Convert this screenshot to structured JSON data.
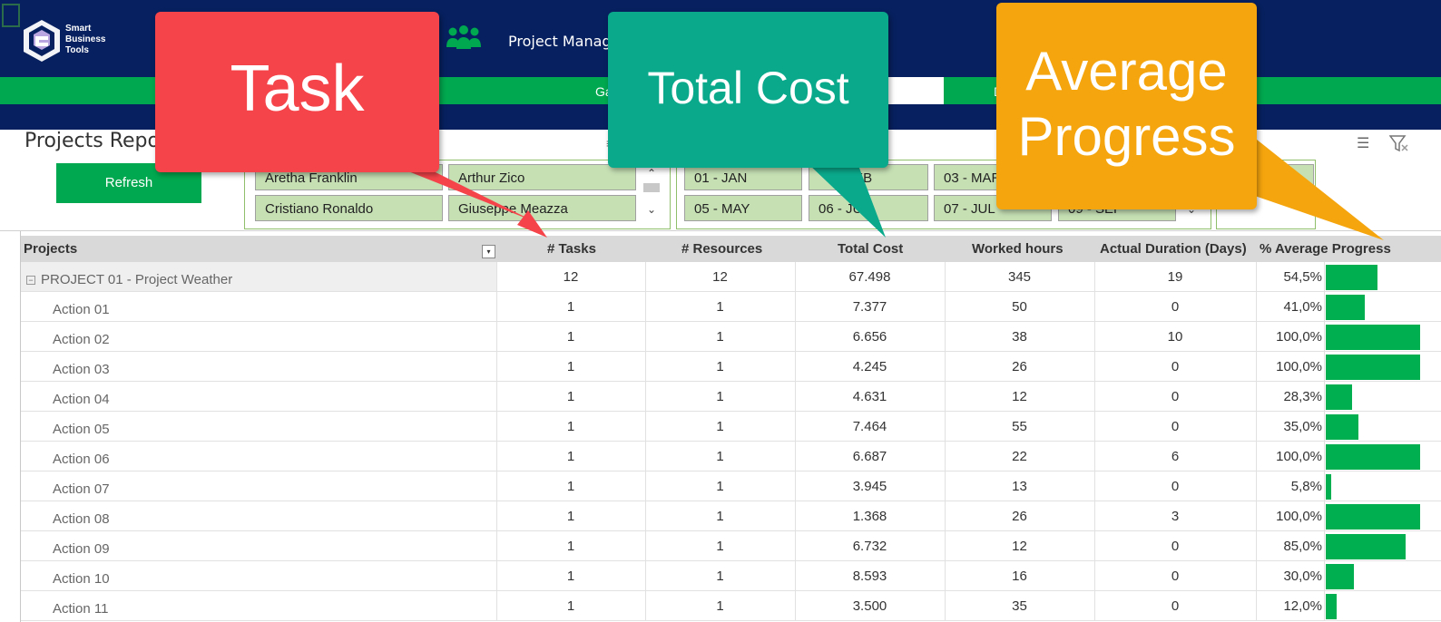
{
  "header": {
    "logo_lines": [
      "Smart",
      "Business",
      "Tools"
    ],
    "app_title": "Project Managem",
    "nav": [
      {
        "label": "Ga",
        "active": false
      },
      {
        "label": "",
        "active": true
      },
      {
        "label": "D",
        "active": false
      }
    ],
    "people_icon": "people-icon"
  },
  "controls": {
    "report_title": "Projects Repo",
    "refresh_label": "Refresh",
    "resource_chips": [
      "Aretha Franklin",
      "Arthur Zico",
      "Cristiano Ronaldo",
      "Giuseppe Meazza"
    ],
    "month_chips": [
      "01 - JAN",
      "FEB",
      "03 - MAR",
      "05 - MAY",
      "06 - JU",
      "07 - JUL",
      "09 - SEP"
    ],
    "icons": [
      "multi-select-icon",
      "clear-filter-icon"
    ]
  },
  "table": {
    "headers": {
      "projects": "Projects",
      "tasks": "# Tasks",
      "resources": "# Resources",
      "total_cost": "Total Cost",
      "worked_hours": "Worked hours",
      "duration": "Actual Duration (Days)",
      "progress": "% Average Progress"
    },
    "rows": [
      {
        "name": "PROJECT 01 - Project Weather",
        "is_project": true,
        "tasks": "12",
        "resources": "12",
        "cost": "67.498",
        "hours": "345",
        "days": "19",
        "pct": "54,5%",
        "progress": 0.545
      },
      {
        "name": "Action 01",
        "is_project": false,
        "tasks": "1",
        "resources": "1",
        "cost": "7.377",
        "hours": "50",
        "days": "0",
        "pct": "41,0%",
        "progress": 0.41
      },
      {
        "name": "Action 02",
        "is_project": false,
        "tasks": "1",
        "resources": "1",
        "cost": "6.656",
        "hours": "38",
        "days": "10",
        "pct": "100,0%",
        "progress": 1.0
      },
      {
        "name": "Action 03",
        "is_project": false,
        "tasks": "1",
        "resources": "1",
        "cost": "4.245",
        "hours": "26",
        "days": "0",
        "pct": "100,0%",
        "progress": 1.0
      },
      {
        "name": "Action 04",
        "is_project": false,
        "tasks": "1",
        "resources": "1",
        "cost": "4.631",
        "hours": "12",
        "days": "0",
        "pct": "28,3%",
        "progress": 0.283
      },
      {
        "name": "Action 05",
        "is_project": false,
        "tasks": "1",
        "resources": "1",
        "cost": "7.464",
        "hours": "55",
        "days": "0",
        "pct": "35,0%",
        "progress": 0.35
      },
      {
        "name": "Action 06",
        "is_project": false,
        "tasks": "1",
        "resources": "1",
        "cost": "6.687",
        "hours": "22",
        "days": "6",
        "pct": "100,0%",
        "progress": 1.0
      },
      {
        "name": "Action 07",
        "is_project": false,
        "tasks": "1",
        "resources": "1",
        "cost": "3.945",
        "hours": "13",
        "days": "0",
        "pct": "5,8%",
        "progress": 0.058
      },
      {
        "name": "Action 08",
        "is_project": false,
        "tasks": "1",
        "resources": "1",
        "cost": "1.368",
        "hours": "26",
        "days": "3",
        "pct": "100,0%",
        "progress": 1.0
      },
      {
        "name": "Action 09",
        "is_project": false,
        "tasks": "1",
        "resources": "1",
        "cost": "6.732",
        "hours": "12",
        "days": "0",
        "pct": "85,0%",
        "progress": 0.85
      },
      {
        "name": "Action 10",
        "is_project": false,
        "tasks": "1",
        "resources": "1",
        "cost": "8.593",
        "hours": "16",
        "days": "0",
        "pct": "30,0%",
        "progress": 0.3
      },
      {
        "name": "Action 11",
        "is_project": false,
        "tasks": "1",
        "resources": "1",
        "cost": "3.500",
        "hours": "35",
        "days": "0",
        "pct": "12,0%",
        "progress": 0.12
      }
    ]
  },
  "callouts": {
    "task": "Task",
    "total_cost": "Total Cost",
    "avg_progress_line1": "Average",
    "avg_progress_line2": "Progress"
  },
  "colors": {
    "header_bg": "#07205f",
    "accent_green": "#00a84f",
    "bar_green": "#00b050",
    "callout_red": "#f5444a",
    "callout_teal": "#0aa98c",
    "callout_orange": "#f5a50d"
  }
}
